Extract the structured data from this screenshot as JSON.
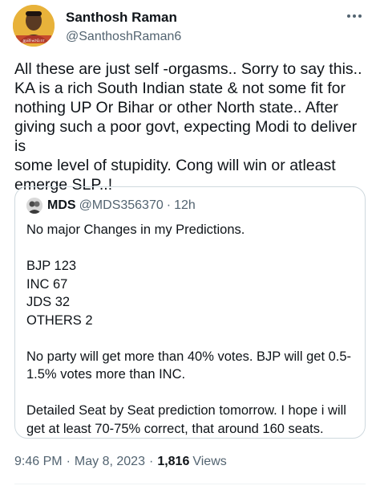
{
  "author": {
    "display_name": "Santhosh Raman",
    "handle": "@SanthoshRaman6",
    "avatar_icon": "profile-photo-avatar",
    "avatar_caption": "தலைவா"
  },
  "tweet": {
    "text": "All these are just self -orgasms.. Sorry to say this..\nKA is a rich South Indian state & not some fit for\nnothing UP Or Bihar or other North state.. After\ngiving such a poor govt, expecting Modi to deliver is\nsome level of stupidity. Cong will win or atleast\nemerge SLP..!",
    "more_icon": "more-options-icon"
  },
  "quoted": {
    "name": "MDS",
    "handle": "@MDS356370",
    "dot": "·",
    "time": "12h",
    "text": "No major Changes in my Predictions.\n\nBJP 123\nINC 67\nJDS 32\nOTHERS 2\n\nNo party will get more than 40% votes. BJP will get 0.5-\n1.5% votes more than INC.\n\nDetailed Seat by Seat prediction tomorrow. I hope i will\nget at least 70-75% correct, that around 160 seats."
  },
  "meta": {
    "time": "9:46 PM",
    "sep": "·",
    "date": "May 8, 2023",
    "views_count": "1,816",
    "views_label": "Views"
  },
  "colors": {
    "text": "#0f1419",
    "secondary": "#536471",
    "border": "#cfd9de",
    "avatar_bg": "#e8b23a"
  }
}
